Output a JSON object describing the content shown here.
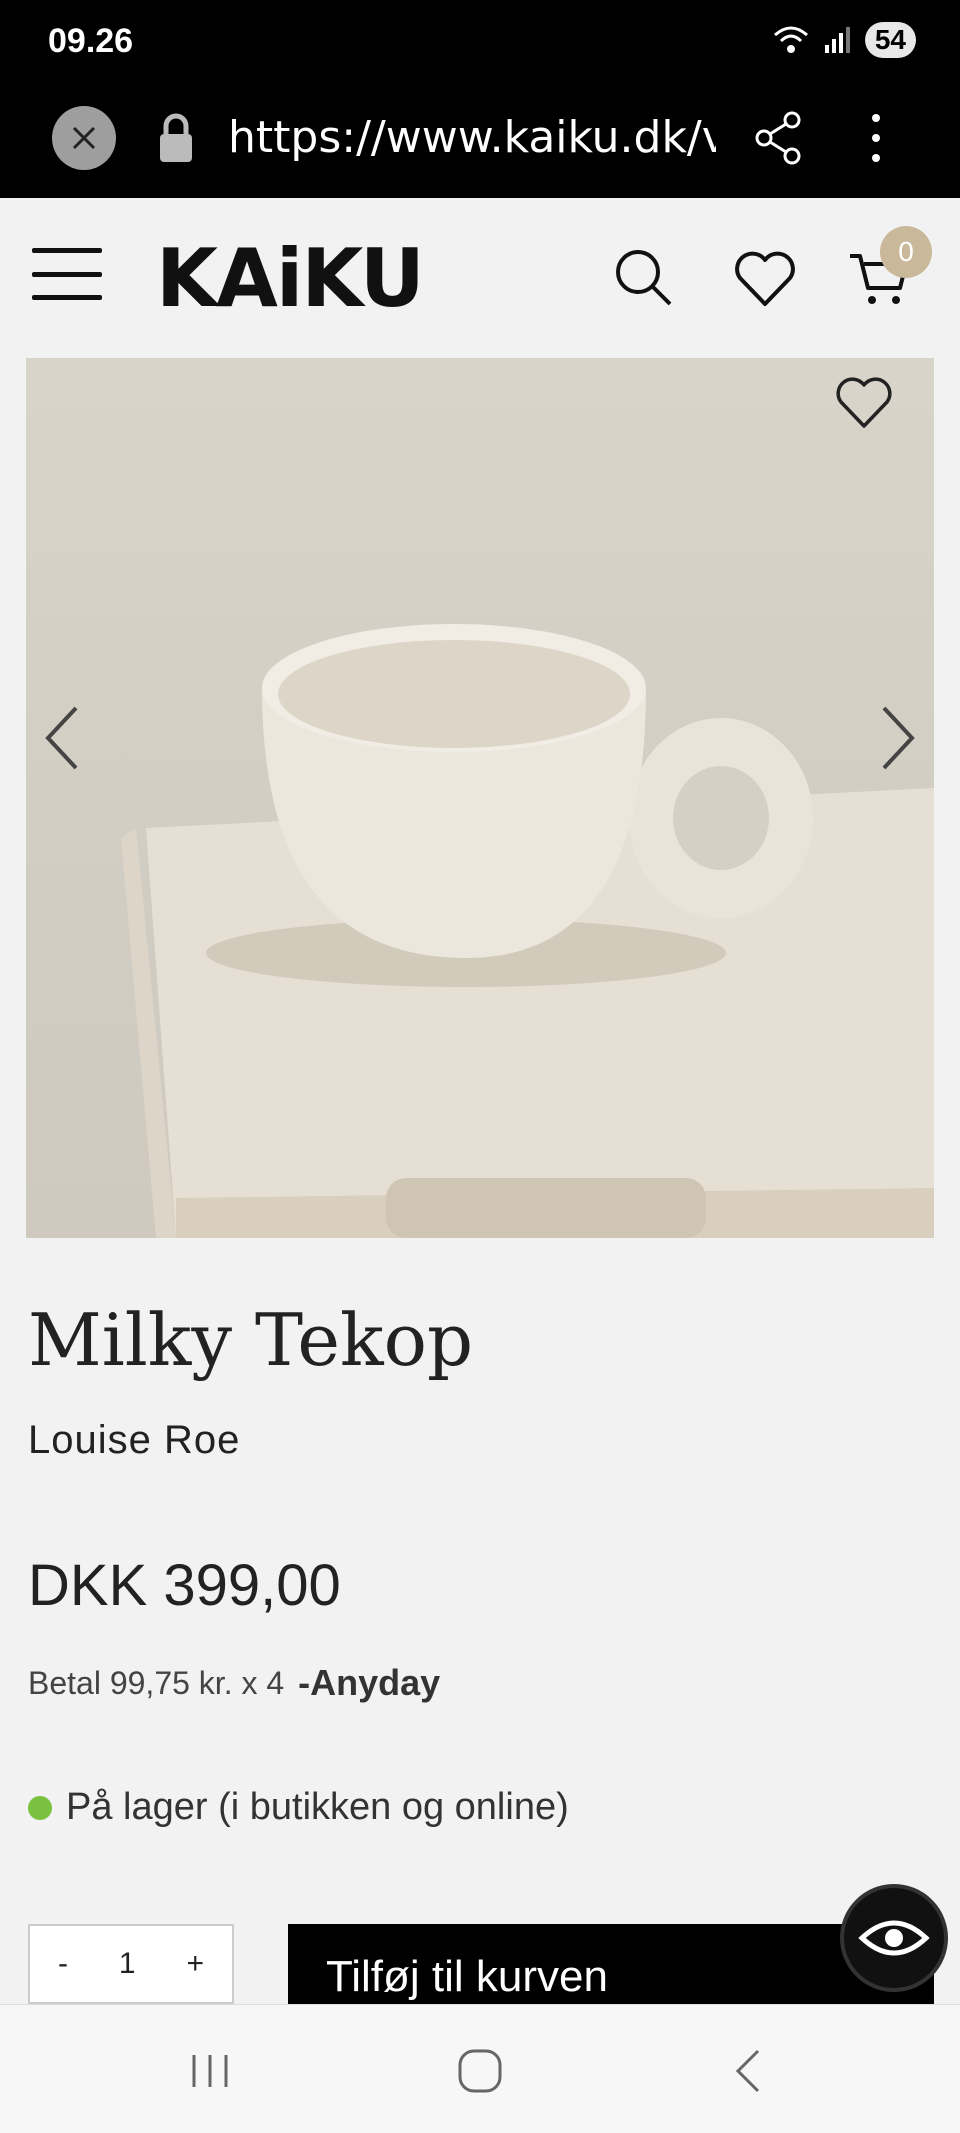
{
  "status_bar": {
    "time": "09.26",
    "battery": "54"
  },
  "browser": {
    "url": "https://www.kaiku.dk/varer/milky-tekop"
  },
  "header": {
    "logo": "KAiKU",
    "cart_count": "0"
  },
  "product": {
    "title": "Milky Tekop",
    "brand": "Louise Roe",
    "price": "DKK 399,00",
    "installment_text": "Betal 99,75 kr. x 4",
    "installment_provider": "Anyday",
    "stock_status": "På lager (i butikken og online)"
  },
  "cart_controls": {
    "minus": "-",
    "quantity": "1",
    "plus": "+",
    "add_label": "Tilføj til kurven"
  },
  "colors": {
    "accent": "#c9b89a",
    "in_stock": "#7ac142",
    "dark": "#000000"
  }
}
